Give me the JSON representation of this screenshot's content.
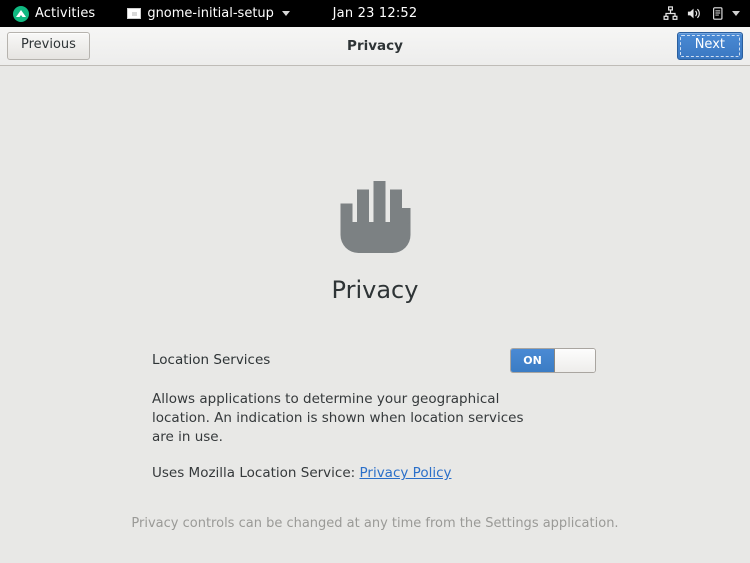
{
  "topbar": {
    "activities_label": "Activities",
    "activities_icon": "rocky-logo-icon",
    "app_name": "gnome-initial-setup",
    "app_icon": "window-icon",
    "app_caret_icon": "chevron-down-icon",
    "clock": "Jan 23  12:52",
    "status_icons": [
      "network-wired-icon",
      "volume-speaker-icon",
      "battery-icon"
    ],
    "status_caret_icon": "chevron-down-icon"
  },
  "headerbar": {
    "previous_label": "Previous",
    "title": "Privacy",
    "next_label": "Next"
  },
  "main": {
    "hero_icon": "raised-hand-icon",
    "page_title": "Privacy",
    "location_services": {
      "label": "Location Services",
      "switch_state_label": "ON",
      "description": "Allows applications to determine your geographical location. An indication is shown when location services are in use.",
      "service_prefix": "Uses Mozilla Location Service:",
      "link_label": "Privacy Policy"
    },
    "footer_note": "Privacy controls can be changed at any time from the Settings application."
  },
  "colors": {
    "accent_blue": "#3b7cc4",
    "link_blue": "#2a6fc9",
    "topbar_black": "#000000",
    "content_bg": "#e8e8e6",
    "headerbar_bg": "#f1f1f0",
    "hand_gray": "#7c8183",
    "text_dark": "#2e3436",
    "footer_gray": "#9a9a97"
  }
}
